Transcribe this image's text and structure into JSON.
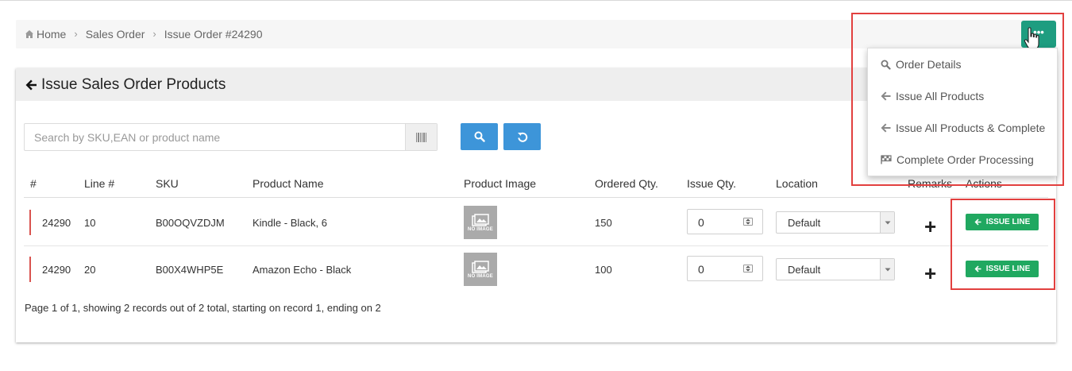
{
  "breadcrumb": {
    "home": "Home",
    "sales_order": "Sales Order",
    "current": "Issue Order #24290"
  },
  "header_menu": {
    "button_label": "•••",
    "items": [
      {
        "label": "Order Details",
        "icon": "search-icon"
      },
      {
        "label": "Issue All Products",
        "icon": "arrow-left-icon"
      },
      {
        "label": "Issue All Products & Complete",
        "icon": "arrow-left-icon"
      },
      {
        "label": "Complete Order Processing",
        "icon": "flag-icon"
      }
    ]
  },
  "panel": {
    "title": "Issue Sales Order Products"
  },
  "search": {
    "placeholder": "Search by SKU,EAN or product name",
    "value": ""
  },
  "table": {
    "columns": [
      "#",
      "Line #",
      "SKU",
      "Product Name",
      "Product Image",
      "Ordered Qty.",
      "Issue Qty.",
      "Location",
      "Remarks",
      "Actions"
    ],
    "rows": [
      {
        "id": "24290",
        "line": "10",
        "sku": "B00OQVZDJM",
        "name": "Kindle - Black, 6",
        "image_text": "NO IMAGE",
        "ordered": "150",
        "issue_qty": "0",
        "location": "Default",
        "remarks": "+",
        "action": "ISSUE LINE"
      },
      {
        "id": "24290",
        "line": "20",
        "sku": "B00X4WHP5E",
        "name": "Amazon Echo - Black",
        "image_text": "NO IMAGE",
        "ordered": "100",
        "issue_qty": "0",
        "location": "Default",
        "remarks": "+",
        "action": "ISSUE LINE"
      }
    ]
  },
  "paging": "Page 1 of 1, showing 2 records out of 2 total, starting on record 1, ending on 2",
  "colors": {
    "accent_green": "#1e9d80",
    "issue_green": "#20a860",
    "button_blue": "#3d95d9",
    "highlight_red": "#e2403f"
  }
}
